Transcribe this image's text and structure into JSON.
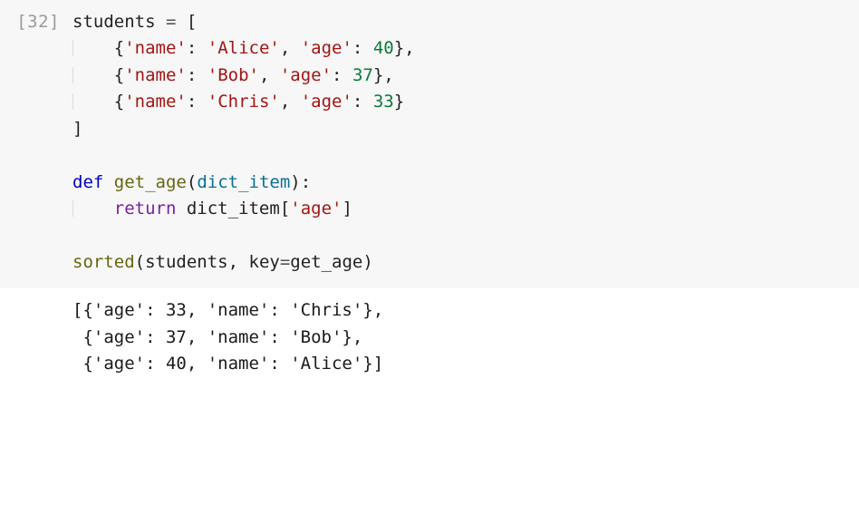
{
  "cell": {
    "prompt_number": 32,
    "prompt_label": "[32]",
    "code": {
      "var_students": "students",
      "assign": " = ",
      "lbracket": "[",
      "items": [
        {
          "name_key": "'name'",
          "name_val": "'Alice'",
          "age_key": "'age'",
          "age_val": "40",
          "trail": ","
        },
        {
          "name_key": "'name'",
          "name_val": "'Bob'",
          "age_key": "'age'",
          "age_val": "37",
          "trail": ","
        },
        {
          "name_key": "'name'",
          "name_val": "'Chris'",
          "age_key": "'age'",
          "age_val": "33",
          "trail": ""
        }
      ],
      "rbracket": "]",
      "kw_def": "def",
      "fn_name": "get_age",
      "lparen": "(",
      "param": "dict_item",
      "rparen_colon": "):",
      "kw_return": "return",
      "return_expr_obj": "dict_item",
      "return_expr_lb": "[",
      "return_expr_key": "'age'",
      "return_expr_rb": "]",
      "call_fn": "sorted",
      "call_lp": "(",
      "call_arg1": "students",
      "call_comma": ", ",
      "call_kwarg": "key",
      "call_eq": "=",
      "call_kwargval": "get_age",
      "call_rp": ")",
      "indent4": "    "
    },
    "output_lines": [
      "[{'age': 33, 'name': 'Chris'},",
      " {'age': 37, 'name': 'Bob'},",
      " {'age': 40, 'name': 'Alice'}]"
    ]
  }
}
